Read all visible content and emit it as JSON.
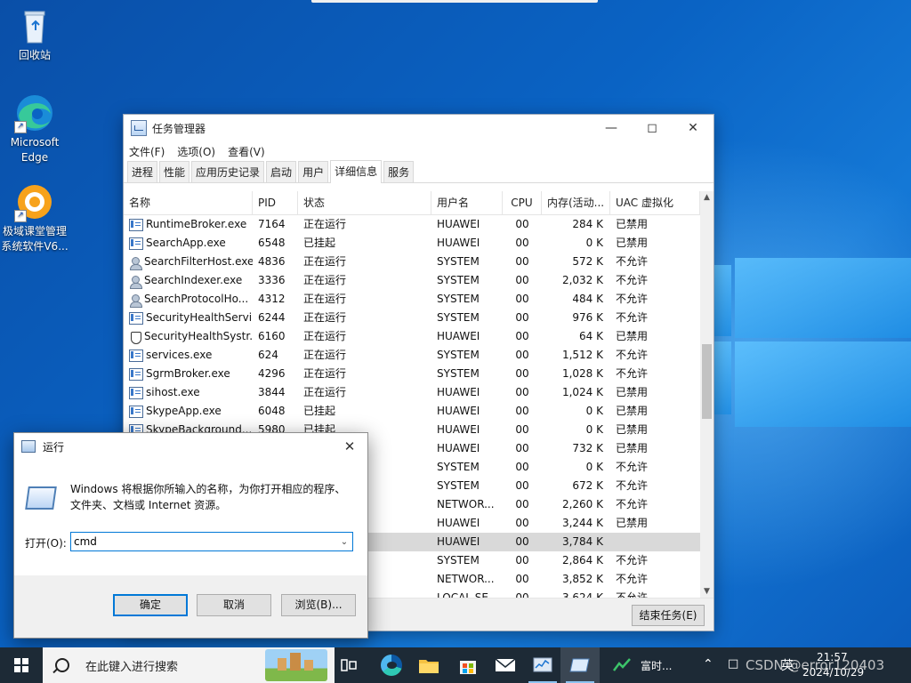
{
  "desktop": {
    "icons": [
      {
        "label": "回收站",
        "icon": "recycle-bin-icon"
      },
      {
        "label": "Microsoft\nEdge",
        "icon": "edge-icon"
      },
      {
        "label": "极域课堂管理\n系统软件V6...",
        "icon": "classroom-manager-icon"
      }
    ]
  },
  "task_manager": {
    "title": "任务管理器",
    "menu": [
      "文件(F)",
      "选项(O)",
      "查看(V)"
    ],
    "tabs": [
      "进程",
      "性能",
      "应用历史记录",
      "启动",
      "用户",
      "详细信息",
      "服务"
    ],
    "active_tab": 5,
    "columns": [
      "名称",
      "PID",
      "状态",
      "用户名",
      "CPU",
      "内存(活动...",
      "UAC 虚拟化"
    ],
    "rows": [
      {
        "name": "RuntimeBroker.exe",
        "pid": "7164",
        "status": "正在运行",
        "user": "HUAWEI",
        "cpu": "00",
        "mem": "284 K",
        "uac": "已禁用",
        "icon": "app"
      },
      {
        "name": "SearchApp.exe",
        "pid": "6548",
        "status": "已挂起",
        "user": "HUAWEI",
        "cpu": "00",
        "mem": "0 K",
        "uac": "已禁用",
        "icon": "app"
      },
      {
        "name": "SearchFilterHost.exe",
        "pid": "4836",
        "status": "正在运行",
        "user": "SYSTEM",
        "cpu": "00",
        "mem": "572 K",
        "uac": "不允许",
        "icon": "user"
      },
      {
        "name": "SearchIndexer.exe",
        "pid": "3336",
        "status": "正在运行",
        "user": "SYSTEM",
        "cpu": "00",
        "mem": "2,032 K",
        "uac": "不允许",
        "icon": "user"
      },
      {
        "name": "SearchProtocolHo...",
        "pid": "4312",
        "status": "正在运行",
        "user": "SYSTEM",
        "cpu": "00",
        "mem": "484 K",
        "uac": "不允许",
        "icon": "user"
      },
      {
        "name": "SecurityHealthServi...",
        "pid": "6244",
        "status": "正在运行",
        "user": "SYSTEM",
        "cpu": "00",
        "mem": "976 K",
        "uac": "不允许",
        "icon": "app"
      },
      {
        "name": "SecurityHealthSystr...",
        "pid": "6160",
        "status": "正在运行",
        "user": "HUAWEI",
        "cpu": "00",
        "mem": "64 K",
        "uac": "已禁用",
        "icon": "shield"
      },
      {
        "name": "services.exe",
        "pid": "624",
        "status": "正在运行",
        "user": "SYSTEM",
        "cpu": "00",
        "mem": "1,512 K",
        "uac": "不允许",
        "icon": "app"
      },
      {
        "name": "SgrmBroker.exe",
        "pid": "4296",
        "status": "正在运行",
        "user": "SYSTEM",
        "cpu": "00",
        "mem": "1,028 K",
        "uac": "不允许",
        "icon": "app"
      },
      {
        "name": "sihost.exe",
        "pid": "3844",
        "status": "正在运行",
        "user": "HUAWEI",
        "cpu": "00",
        "mem": "1,024 K",
        "uac": "已禁用",
        "icon": "app"
      },
      {
        "name": "SkypeApp.exe",
        "pid": "6048",
        "status": "已挂起",
        "user": "HUAWEI",
        "cpu": "00",
        "mem": "0 K",
        "uac": "已禁用",
        "icon": "app"
      },
      {
        "name": "SkypeBackground...",
        "pid": "5980",
        "status": "已挂起",
        "user": "HUAWEI",
        "cpu": "00",
        "mem": "0 K",
        "uac": "已禁用",
        "icon": "app"
      },
      {
        "name": "",
        "pid": "",
        "status": "",
        "user": "HUAWEI",
        "cpu": "00",
        "mem": "732 K",
        "uac": "已禁用",
        "icon": "none"
      },
      {
        "name": "",
        "pid": "",
        "status": "",
        "user": "SYSTEM",
        "cpu": "00",
        "mem": "0 K",
        "uac": "不允许",
        "icon": "none"
      },
      {
        "name": "",
        "pid": "",
        "status": "",
        "user": "SYSTEM",
        "cpu": "00",
        "mem": "672 K",
        "uac": "不允许",
        "icon": "none"
      },
      {
        "name": "",
        "pid": "",
        "status": "",
        "user": "NETWOR...",
        "cpu": "00",
        "mem": "2,260 K",
        "uac": "不允许",
        "icon": "none"
      },
      {
        "name": "",
        "pid": "",
        "status": "",
        "user": "HUAWEI",
        "cpu": "00",
        "mem": "3,244 K",
        "uac": "已禁用",
        "icon": "none"
      },
      {
        "name": "",
        "pid": "",
        "status": "",
        "user": "HUAWEI",
        "cpu": "00",
        "mem": "3,784 K",
        "uac": "",
        "icon": "none",
        "selected": true
      },
      {
        "name": "",
        "pid": "",
        "status": "",
        "user": "SYSTEM",
        "cpu": "00",
        "mem": "2,864 K",
        "uac": "不允许",
        "icon": "none"
      },
      {
        "name": "",
        "pid": "",
        "status": "",
        "user": "NETWOR...",
        "cpu": "00",
        "mem": "3,852 K",
        "uac": "不允许",
        "icon": "none"
      },
      {
        "name": "",
        "pid": "",
        "status": "",
        "user": "LOCAL SE...",
        "cpu": "00",
        "mem": "3,624 K",
        "uac": "不允许",
        "icon": "none"
      }
    ],
    "end_task_label": "结束任务(E)"
  },
  "run_dialog": {
    "title": "运行",
    "description": "Windows 将根据你所输入的名称，为你打开相应的程序、文件夹、文档或 Internet 资源。",
    "open_label": "打开(O):",
    "input_value": "cmd",
    "ok_label": "确定",
    "cancel_label": "取消",
    "browse_label": "浏览(B)..."
  },
  "taskbar": {
    "search_placeholder": "在此键入进行搜索",
    "running_app_label": "富时...",
    "ime_label": "英",
    "time": "21:57",
    "date": "2024/10/29",
    "watermark": "CSDN @error120403"
  },
  "colors": {
    "accent": "#0078d7",
    "taskbar": "#1d2a36",
    "selected_row": "#d9d9d9"
  }
}
